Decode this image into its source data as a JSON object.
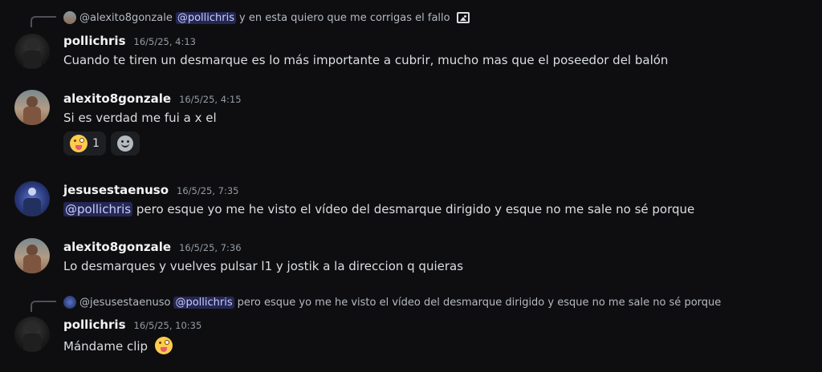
{
  "messages": [
    {
      "reply": {
        "author": "@alexito8gonzale",
        "mention": "@pollichris",
        "text": "y en esta quiero que me corrigas el fallo",
        "icon": "image-icon"
      },
      "author": "pollichris",
      "timestamp": "16/5/25, 4:13",
      "content": "Cuando te tiren un desmarque es lo más importante a cubrir, mucho mas que el poseedor del balón"
    },
    {
      "author": "alexito8gonzale",
      "timestamp": "16/5/25, 4:15",
      "content": "Si es verdad me fui a x el",
      "reactions": [
        {
          "emoji": "winking-face-with-tongue",
          "count": "1"
        }
      ],
      "add_reaction_icon": "add-reaction-icon"
    },
    {
      "author": "jesusestaenuso",
      "timestamp": "16/5/25, 7:35",
      "mention": "@pollichris",
      "content": "pero esque yo me he visto el vídeo del desmarque dirigido y esque no me sale no sé porque"
    },
    {
      "author": "alexito8gonzale",
      "timestamp": "16/5/25, 7:36",
      "content": "Lo desmarques y vuelves pulsar l1 y jostik a la direccion q quieras"
    },
    {
      "reply": {
        "author": "@jesusestaenuso",
        "mention": "@pollichris",
        "text": "pero esque yo me he visto el vídeo del desmarque dirigido y esque no me sale no sé porque"
      },
      "author": "pollichris",
      "timestamp": "16/5/25, 10:35",
      "content": "Mándame clip",
      "emoji": "winking-face-with-tongue"
    }
  ],
  "colors": {
    "background": "#0e0e10",
    "mention_bg": "#3a3f7a",
    "mention_text": "#c9cdfb",
    "timestamp": "#949ba4"
  }
}
